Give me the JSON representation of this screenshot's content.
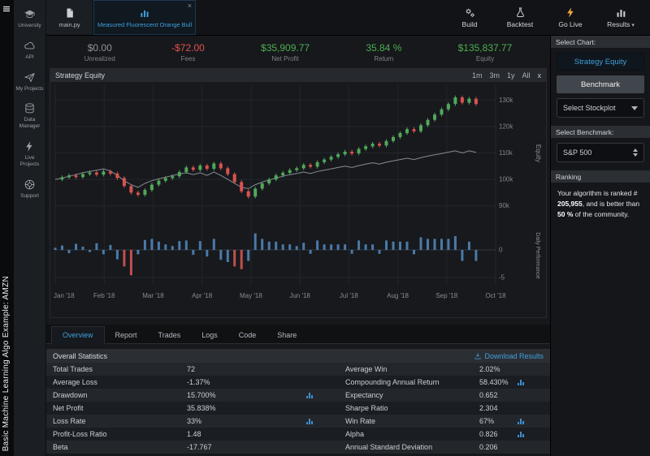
{
  "sidebar": {
    "project_title": "Basic Machine Learning Algo Example: AMZN",
    "items": [
      {
        "label": "University",
        "icon": "graduation-cap"
      },
      {
        "label": "API",
        "icon": "cloud"
      },
      {
        "label": "My Projects",
        "icon": "paper-plane"
      },
      {
        "label": "Data Manager",
        "icon": "database"
      },
      {
        "label": "Live Projects",
        "icon": "lightning"
      },
      {
        "label": "Support",
        "icon": "lifebuoy"
      }
    ]
  },
  "header": {
    "tabs": [
      {
        "label": "main.py",
        "icon": "file",
        "active": false,
        "closable": false
      },
      {
        "label": "Measured Fluorescent Orange Bull",
        "icon": "chart",
        "active": true,
        "closable": true
      }
    ],
    "close_glyph": "×",
    "actions": [
      {
        "label": "Build",
        "icon": "gears"
      },
      {
        "label": "Backtest",
        "icon": "flask"
      },
      {
        "label": "Go Live",
        "icon": "lightning",
        "color": "#f0a73c"
      },
      {
        "label": "Results",
        "icon": "chart",
        "caret": true
      }
    ]
  },
  "stats": [
    {
      "value": "$0.00",
      "label": "Unrealized",
      "color": "muted"
    },
    {
      "value": "-$72.00",
      "label": "Fees",
      "color": "red"
    },
    {
      "value": "$35,909.77",
      "label": "Net Profit",
      "color": "green"
    },
    {
      "value": "35.84 %",
      "label": "Return",
      "color": "green"
    },
    {
      "value": "$135,837.77",
      "label": "Equity",
      "color": "green"
    }
  ],
  "chart_panel": {
    "title": "Strategy Equity",
    "ranges": [
      "1m",
      "3m",
      "1y",
      "All"
    ],
    "close_label": "x",
    "y_axis_label": "Equity",
    "y2_axis_label": "Daily Performance",
    "y_ticks": [
      "130k",
      "120k",
      "110k",
      "100k",
      "90k"
    ],
    "y2_ticks": [
      "0",
      "-5"
    ],
    "x_labels": [
      "Jan '18",
      "Feb '18",
      "Mar '18",
      "Apr '18",
      "May '18",
      "Jun '18",
      "Jul '18",
      "Aug '18",
      "Sep '18",
      "Oct '18"
    ]
  },
  "chart_data": {
    "type": "candlestick",
    "title": "Strategy Equity",
    "x_range": [
      "Jan '18",
      "Oct '18"
    ],
    "y_ticks_values": [
      130,
      120,
      110,
      100,
      90
    ],
    "y_units": "k",
    "y2_ticks_values": [
      0,
      -5
    ],
    "series": [
      {
        "name": "Equity",
        "type": "candlestick",
        "color_up": "#51a85a",
        "color_down": "#d9534f",
        "closes": [
          100.0,
          100.8,
          101.5,
          100.9,
          102.0,
          102.6,
          101.8,
          103.0,
          102.2,
          100.5,
          97.5,
          95.0,
          94.2,
          96.0,
          98.0,
          99.5,
          100.5,
          101.2,
          102.8,
          104.5,
          103.6,
          105.2,
          104.0,
          106.0,
          104.2,
          102.0,
          99.0,
          95.5,
          93.5,
          96.5,
          98.5,
          100.0,
          101.5,
          102.5,
          103.5,
          104.2,
          105.5,
          104.8,
          106.5,
          107.5,
          108.5,
          109.5,
          110.5,
          109.8,
          111.5,
          112.5,
          113.5,
          112.8,
          114.5,
          116.0,
          117.5,
          119.0,
          118.2,
          120.5,
          122.5,
          124.5,
          126.5,
          128.5,
          131.0,
          129.0,
          130.5,
          128.5
        ]
      },
      {
        "name": "Benchmark",
        "type": "line",
        "color": "#9ba1a7",
        "values": [
          100.0,
          100.5,
          101.2,
          101.8,
          102.5,
          103.0,
          103.5,
          104.0,
          103.2,
          101.5,
          99.5,
          98.0,
          97.0,
          98.5,
          99.5,
          100.2,
          100.8,
          101.5,
          102.0,
          102.5,
          101.8,
          102.5,
          101.5,
          102.8,
          101.5,
          100.0,
          98.5,
          97.0,
          96.5,
          98.0,
          99.0,
          99.8,
          100.5,
          101.2,
          101.8,
          102.2,
          102.8,
          102.2,
          103.0,
          103.5,
          104.0,
          104.5,
          105.0,
          104.5,
          105.2,
          105.8,
          106.3,
          105.8,
          106.5,
          107.0,
          107.5,
          108.0,
          107.5,
          108.2,
          108.8,
          109.3,
          109.8,
          110.3,
          110.8,
          110.0,
          110.8,
          110.2
        ]
      },
      {
        "name": "Daily Performance",
        "type": "bar",
        "color": "#4a7aa8",
        "color_negative_big": "#c0504d",
        "values": [
          0.4,
          0.8,
          -0.6,
          1.1,
          0.6,
          -0.4,
          1.2,
          -0.8,
          0.9,
          -1.7,
          -3.0,
          -4.6,
          -0.8,
          1.8,
          2.0,
          1.5,
          1.0,
          0.7,
          1.6,
          1.7,
          -0.9,
          1.6,
          -1.2,
          2.0,
          -1.8,
          -2.2,
          -3.0,
          -3.5,
          -2.0,
          3.0,
          2.0,
          1.5,
          1.5,
          1.0,
          1.0,
          0.7,
          1.3,
          -0.7,
          1.7,
          1.0,
          1.0,
          1.0,
          1.0,
          -0.7,
          1.7,
          1.0,
          1.0,
          -0.7,
          1.7,
          1.5,
          1.5,
          1.5,
          -0.8,
          2.3,
          2.0,
          2.0,
          2.0,
          2.0,
          2.5,
          -2.0,
          1.5,
          -2.0
        ]
      }
    ]
  },
  "results_tabs": [
    {
      "label": "Overview",
      "active": true
    },
    {
      "label": "Report",
      "active": false
    },
    {
      "label": "Trades",
      "active": false
    },
    {
      "label": "Logs",
      "active": false
    },
    {
      "label": "Code",
      "active": false
    },
    {
      "label": "Share",
      "active": false
    }
  ],
  "statistics": {
    "title": "Overall Statistics",
    "download_label": "Download Results",
    "rows": [
      [
        "Total Trades",
        "72",
        "Average Win",
        "2.02%"
      ],
      [
        "Average Loss",
        "-1.37%",
        "Compounding Annual Return",
        "58.430%"
      ],
      [
        "Drawdown",
        "15.700%",
        "Expectancy",
        "0.652"
      ],
      [
        "Net Profit",
        "35.838%",
        "Sharpe Ratio",
        "2.304"
      ],
      [
        "Loss Rate",
        "33%",
        "Win Rate",
        "67%"
      ],
      [
        "Profit-Loss Ratio",
        "1.48",
        "Alpha",
        "0.826"
      ],
      [
        "Beta",
        "-17.767",
        "Annual Standard Deviation",
        "0.206"
      ]
    ],
    "sparkline_cells": [
      [
        1,
        3
      ],
      [
        2,
        1
      ],
      [
        4,
        1
      ],
      [
        4,
        3
      ],
      [
        5,
        3
      ]
    ]
  },
  "right_panel": {
    "select_chart_label": "Select Chart:",
    "buttons": [
      {
        "label": "Strategy Equity",
        "style": "primary"
      },
      {
        "label": "Benchmark",
        "style": "secondary"
      }
    ],
    "stockplot_select": "Select Stockplot",
    "select_benchmark_label": "Select Benchmark:",
    "benchmark_select": "S&P 500",
    "ranking_title": "Ranking",
    "ranking": {
      "prefix": "Your algorithm is ranked #",
      "rank": "205,955",
      "middle": ", and is better than",
      "percent": "50 %",
      "suffix": "of the community."
    }
  },
  "colors": {
    "accent_blue": "#3fa0dc",
    "green": "#4cae4f",
    "red": "#e0524e",
    "orange": "#f0a73c"
  }
}
